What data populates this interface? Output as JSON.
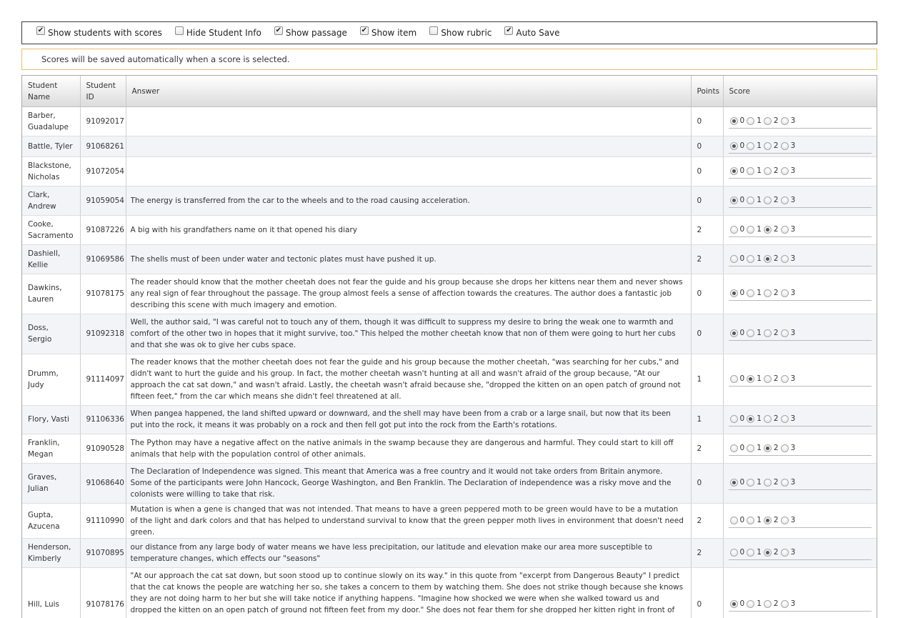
{
  "options": [
    {
      "label": "Show students with scores",
      "checked": true
    },
    {
      "label": "Hide Student Info",
      "checked": false
    },
    {
      "label": "Show passage",
      "checked": true
    },
    {
      "label": "Show item",
      "checked": true
    },
    {
      "label": "Show rubric",
      "checked": false
    },
    {
      "label": "Auto Save",
      "checked": true
    }
  ],
  "notice": "Scores will be saved automatically when a score is selected.",
  "columns": {
    "name": "Student Name",
    "id": "Student ID",
    "answer": "Answer",
    "points": "Points",
    "score": "Score"
  },
  "score_options": [
    "0",
    "1",
    "2",
    "3"
  ],
  "rows": [
    {
      "name": "Barber, Guadalupe",
      "id": "91092017",
      "answer": "",
      "points": "0",
      "score": 0
    },
    {
      "name": "Battle, Tyler",
      "id": "91068261",
      "answer": "",
      "points": "0",
      "score": 0
    },
    {
      "name": "Blackstone, Nicholas",
      "id": "91072054",
      "answer": "",
      "points": "0",
      "score": 0
    },
    {
      "name": "Clark, Andrew",
      "id": "91059054",
      "answer": "The energy is transferred from the car to the wheels and to the road causing acceleration.",
      "points": "0",
      "score": 0
    },
    {
      "name": "Cooke, Sacramento",
      "id": "91087226",
      "answer": "A big with his grandfathers name on it that opened his diary",
      "points": "2",
      "score": 2
    },
    {
      "name": "Dashiell, Kellie",
      "id": "91069586",
      "answer": "The shells must of been under water and tectonic plates must have pushed it up.",
      "points": "2",
      "score": 2
    },
    {
      "name": "Dawkins, Lauren",
      "id": "91078175",
      "answer": "The reader should know that the mother cheetah does not fear the guide and his group because she drops her kittens near them and never shows any real sign of fear throughout the passage. The group almost feels a sense of affection towards the creatures. The author does a fantastic job describing this scene with much imagery and emotion.",
      "points": "0",
      "score": 0
    },
    {
      "name": "Doss, Sergio",
      "id": "91092318",
      "answer": "Well, the author said, \"I was careful not to touch any of them, though it was difficult to suppress my desire to bring the weak one to warmth and comfort of the other two in hopes that it might survive, too.\" This helped the mother cheetah know that non of them were going to hurt her cubs and that she was ok to give her cubs space.",
      "points": "0",
      "score": 0
    },
    {
      "name": "Drumm, Judy",
      "id": "91114097",
      "answer": "The reader knows that the mother cheetah does not fear the guide and his group because the mother cheetah, \"was searching for her cubs,\" and didn't want to hurt the guide and his group. In fact, the mother cheetah wasn't hunting at all and wasn't afraid of the group because, \"At our approach the cat sat down,\" and wasn't afraid. Lastly, the cheetah wasn't afraid because she, \"dropped the kitten on an open patch of ground not fifteen feet,\" from the car which means she didn't feel threatened at all.",
      "points": "1",
      "score": 1
    },
    {
      "name": "Flory, Vasti",
      "id": "91106336",
      "answer": "When pangea happened, the land shifted upward or downward, and the shell may have been from a crab or a large snail, but now that its been put into the rock, it means it was probably on a rock and then fell got put into the rock from the Earth's rotations.",
      "points": "1",
      "score": 1
    },
    {
      "name": "Franklin, Megan",
      "id": "91090528",
      "answer": "The Python may have a negative affect on the native animals in the swamp because they are dangerous and harmful. They could start to kill off animals that help with the population control of other animals.",
      "points": "2",
      "score": 2
    },
    {
      "name": "Graves, Julian",
      "id": "91068640",
      "answer": "The Declaration of Independence was signed. This meant that America was a free country and it would not take orders from Britain anymore. Some of the participants were John Hancock, George Washington, and Ben Franklin. The Declaration of independence was a risky move and the colonists were willing to take that risk.",
      "points": "0",
      "score": 0
    },
    {
      "name": "Gupta, Azucena",
      "id": "91110990",
      "answer": "Mutation is when a gene is changed that was not intended. That means to have a green peppered moth to be green would have to be a mutation of the light and dark colors and that has helped to understand survival to know that the green pepper moth lives in environment that doesn't need green.",
      "points": "2",
      "score": 2
    },
    {
      "name": "Henderson, Kimberly",
      "id": "91070895",
      "answer": "our distance from any large body of water means we have less precipitation, our latitude and elevation make our area more susceptible to temperature changes, which effects our \"seasons\"",
      "points": "2",
      "score": 2
    },
    {
      "name": "Hill, Luis",
      "id": "91078176",
      "answer": "\"At our approach the cat sat down, but soon stood up to continue slowly on its way.\" in this quote from \"excerpt from Dangerous Beauty\" I predict that the cat knows the people are watching her so, she takes a concern to them by watching them. She does not strike though because she knows they are not doing harm to her but she will take notice if anything happens. \"Imagine how shocked we were when she walked toward us and dropped the kitten on an open patch of ground not fifteen feet from my door.\" She does not fear them for she dropped her kitten right in front of him. She has relaxed and got to know the people and what there attentions are. \"When I was absolutely positive that the mother had crested the rise and was out of sight, I stepped from the car and measured the",
      "points": "0",
      "score": 0
    }
  ]
}
